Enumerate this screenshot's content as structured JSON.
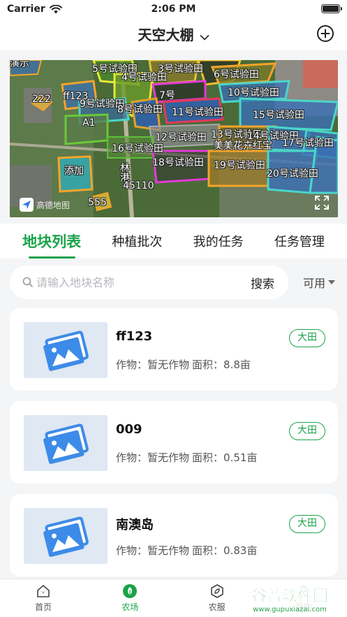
{
  "status": {
    "carrier": "Carrier",
    "time": "2:06 PM"
  },
  "nav": {
    "title": "天空大棚"
  },
  "map": {
    "labels": [
      "5号试验田",
      "3号试验田",
      "4号试验田",
      "6号试验田",
      "10号试验田",
      "ff123",
      "9号试验田",
      "7号",
      "8号试验田",
      "11号试验田",
      "15号试验田",
      "A1",
      "12号试验田",
      "13号试验田",
      "14号试验田",
      "17号试验田",
      "16号试验田",
      "美美花卉红宝",
      "18号试验田",
      "19号试验田",
      "20号试验田",
      "222",
      "添加",
      "林",
      "港",
      "45110",
      "555",
      "演示"
    ],
    "provider": "高德地图"
  },
  "tabs": [
    "地块列表",
    "种植批次",
    "我的任务",
    "任务管理"
  ],
  "search": {
    "placeholder": "请输入地块名称",
    "button": "搜索",
    "filter": "可用"
  },
  "plots": [
    {
      "name": "ff123",
      "crop_label": "作物：",
      "crop": "暂无作物",
      "area_label": "面积：",
      "area": "8.8亩",
      "tag": "大田"
    },
    {
      "name": "009",
      "crop_label": "作物：",
      "crop": "暂无作物",
      "area_label": "面积：",
      "area": "0.51亩",
      "tag": "大田"
    },
    {
      "name": "南澳岛",
      "crop_label": "作物：",
      "crop": "暂无作物",
      "area_label": "面积：",
      "area": "0.83亩",
      "tag": "大田"
    }
  ],
  "tabbar": [
    "首页",
    "农场",
    "农服",
    "我的"
  ],
  "watermark": {
    "text": "谷普软件园",
    "url": "www.gupuxiazai.com"
  },
  "colors": {
    "accent": "#1aa34a"
  }
}
